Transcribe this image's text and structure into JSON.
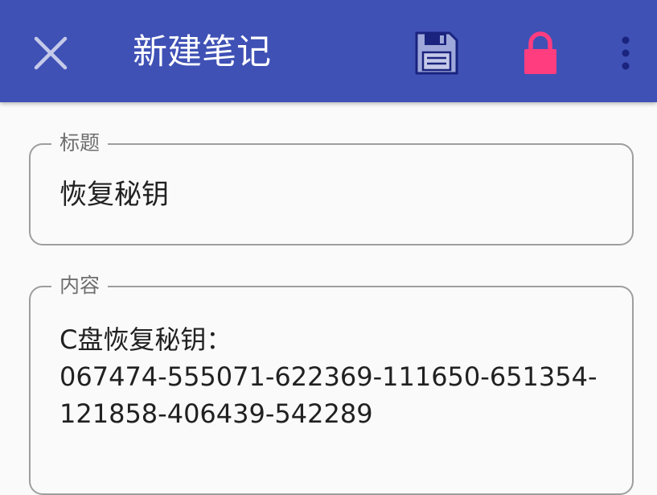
{
  "app_bar": {
    "title": "新建笔记",
    "background_color": "#3f51b5",
    "icons": {
      "close": "close-icon",
      "save": "floppy-disk-icon",
      "lock": "lock-icon",
      "more": "more-vert-icon"
    },
    "lock_color": "#ff3d7f",
    "save_color": "#9fa8da"
  },
  "form": {
    "title_field": {
      "label": "标题",
      "value": "恢复秘钥"
    },
    "content_field": {
      "label": "内容",
      "lines": [
        "C盘恢复秘钥：",
        "067474-555071-622369-111650-651354-",
        "121858-406439-542289"
      ]
    }
  }
}
